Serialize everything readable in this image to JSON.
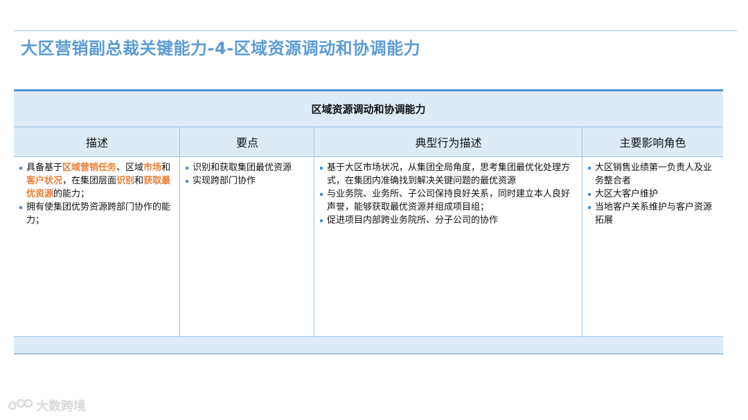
{
  "title": "大区营销副总裁关键能力-4-区域资源调动和协调能力",
  "table": {
    "header": "区域资源调动和协调能力",
    "columns": [
      "描述",
      "要点",
      "典型行为描述",
      "主要影响角色"
    ],
    "description": {
      "item1": {
        "t1": "具备基于",
        "h1": "区域营销任务",
        "t2": "、区域",
        "h2": "市场",
        "t3": "和",
        "h3": "客户状况",
        "t4": "，在集团层面",
        "h4": "识别",
        "t5": "和",
        "h5": "获取最优资源",
        "t6": "的能力；"
      },
      "item2": "拥有使集团优势资源跨部门协作的能力；"
    },
    "key_points": [
      "识别和获取集团最优资源",
      "实现跨部门协作"
    ],
    "behaviors": [
      "基于大区市场状况，从集团全局角度，思考集团最优化处理方式，在集团内准确找到解决关键问题的最优资源",
      "与业务院、业务所、子公司保持良好关系，同时建立本人良好声誉，能够获取最优资源并组成项目组；",
      "促进项目内部跨业务院所、分子公司的协作"
    ],
    "roles": [
      "大区销售业绩第一负责人及业务整合者",
      "大区大客户维护",
      "当地客户关系维护与客户资源拓展"
    ]
  },
  "watermark": {
    "text": "大数跨境",
    "icon": "brand-logo-icon"
  },
  "colors": {
    "title": "#5b9bd5",
    "header_bg": "#deebf7",
    "border": "#4f8fd0",
    "highlight": "#ed7d31"
  }
}
